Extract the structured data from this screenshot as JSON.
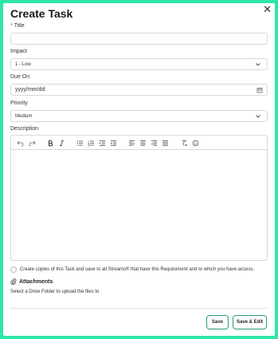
{
  "dialog": {
    "title": "Create Task",
    "close_glyph": "✕"
  },
  "fields": {
    "title": {
      "required_mark": "*",
      "label": "Title",
      "value": ""
    },
    "impact": {
      "label": "Impact",
      "value": "1 - Low"
    },
    "due_on": {
      "label": "Due On",
      "placeholder": "yyyy/mm/dd"
    },
    "priority": {
      "label": "Priority",
      "value": "Medium"
    },
    "description": {
      "label": "Description"
    }
  },
  "toolbar": {
    "icons": [
      "undo-icon",
      "redo-icon",
      "bold-icon",
      "italic-icon",
      "bullet-list-icon",
      "numbered-list-icon",
      "outdent-icon",
      "indent-icon",
      "align-left-icon",
      "align-center-icon",
      "align-right-icon",
      "justify-icon",
      "clear-format-icon",
      "emoji-icon"
    ]
  },
  "copies": {
    "text": "Create copies of this Task and save to all Streams® that have this Requirement and to which you have access."
  },
  "attachments": {
    "heading": "Attachments",
    "drive_label": "Select a Drive Folder to upload the files to"
  },
  "buttons": {
    "save": "Save",
    "save_edit": "Save & Edit"
  },
  "colors": {
    "frame": "#2fe6a6",
    "button_border": "#2a9a7a"
  }
}
